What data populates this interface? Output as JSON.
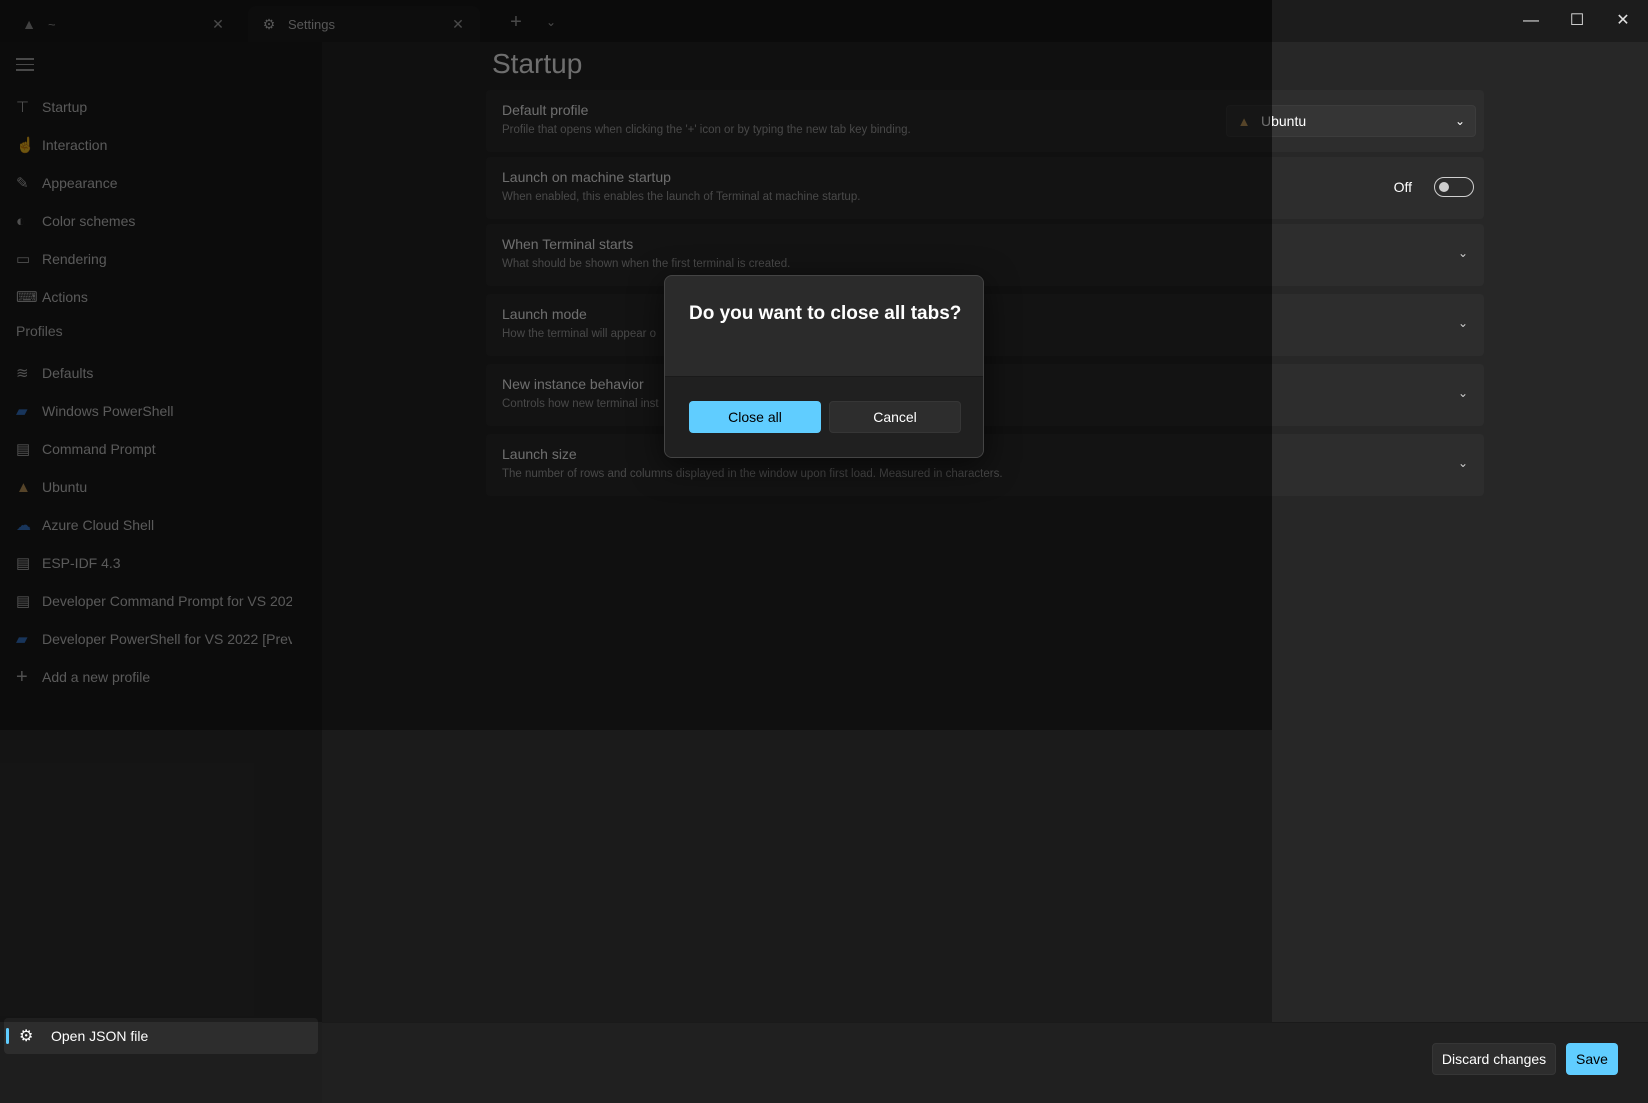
{
  "titlebar": {
    "tabs": [
      {
        "icon": "ubuntu-icon",
        "label": "~"
      },
      {
        "icon": "gear-icon",
        "label": "Settings"
      }
    ],
    "new_tab": "+",
    "dropdown": "⌄",
    "minimize": "—",
    "maximize": "☐",
    "close": "✕"
  },
  "sidebar": {
    "items": [
      {
        "label": "Startup",
        "icon": "startup-icon"
      },
      {
        "label": "Interaction",
        "icon": "interaction-icon"
      },
      {
        "label": "Appearance",
        "icon": "appearance-icon"
      },
      {
        "label": "Color schemes",
        "icon": "palette-icon"
      },
      {
        "label": "Rendering",
        "icon": "monitor-icon"
      },
      {
        "label": "Actions",
        "icon": "keyboard-icon"
      }
    ],
    "profiles_header": "Profiles",
    "profiles": [
      {
        "label": "Defaults",
        "icon": "layers-icon"
      },
      {
        "label": "Windows PowerShell",
        "icon": "powershell-icon"
      },
      {
        "label": "Command Prompt",
        "icon": "cmd-icon"
      },
      {
        "label": "Ubuntu",
        "icon": "ubuntu-icon"
      },
      {
        "label": "Azure Cloud Shell",
        "icon": "azure-icon"
      },
      {
        "label": "ESP-IDF 4.3",
        "icon": "cmd-icon"
      },
      {
        "label": "Developer Command Prompt for VS 202",
        "icon": "cmd-icon"
      },
      {
        "label": "Developer PowerShell for VS 2022 [Previ",
        "icon": "powershell-icon"
      },
      {
        "label": "Add a new profile",
        "icon": "plus-icon"
      }
    ],
    "open_json": "Open JSON file"
  },
  "main": {
    "title": "Startup",
    "cards": [
      {
        "title": "Default profile",
        "subtitle": "Profile that opens when clicking the '+' icon or by typing the new tab key binding.",
        "control": "combo",
        "value": "Ubuntu"
      },
      {
        "title": "Launch on machine startup",
        "subtitle": "When enabled, this enables the launch of Terminal at machine startup.",
        "control": "toggle",
        "value": "Off"
      },
      {
        "title": "When Terminal starts",
        "subtitle": "What should be shown when the first terminal is created.",
        "control": "chevron"
      },
      {
        "title": "Launch mode",
        "subtitle": "How the terminal will appear o",
        "control": "chevron"
      },
      {
        "title": "New instance behavior",
        "subtitle": "Controls how new terminal inst",
        "control": "chevron"
      },
      {
        "title": "Launch size",
        "subtitle": "The number of rows and columns displayed in the window upon first load. Measured in characters.",
        "control": "chevron"
      }
    ]
  },
  "footer": {
    "discard": "Discard changes",
    "save": "Save"
  },
  "dialog": {
    "title": "Do you want to close all tabs?",
    "primary": "Close all",
    "secondary": "Cancel"
  },
  "colors": {
    "accent": "#60cdff",
    "background": "#202020",
    "card": "#2d2d2d"
  }
}
